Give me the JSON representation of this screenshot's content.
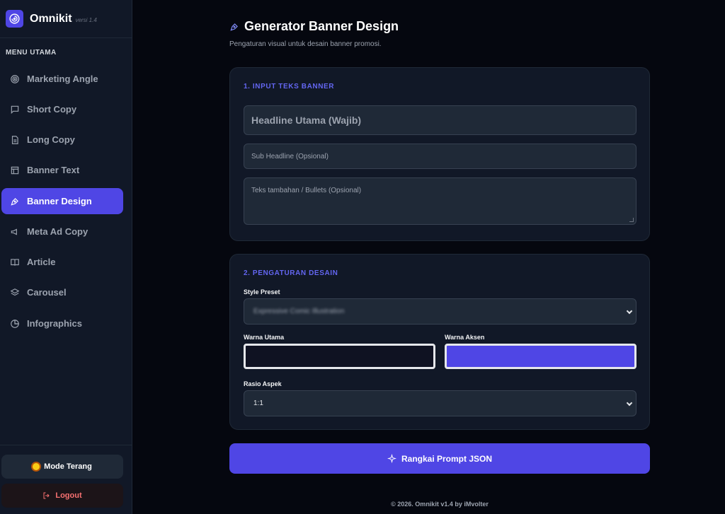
{
  "brand": {
    "name": "Omnikit",
    "version": "versi 1.4"
  },
  "sidebar": {
    "menu_title": "MENU UTAMA",
    "items": [
      {
        "label": "Marketing Angle",
        "icon": "target-icon"
      },
      {
        "label": "Short Copy",
        "icon": "message-square-icon"
      },
      {
        "label": "Long Copy",
        "icon": "file-text-icon"
      },
      {
        "label": "Banner Text",
        "icon": "layout-icon"
      },
      {
        "label": "Banner Design",
        "icon": "pen-tool-icon",
        "active": true
      },
      {
        "label": "Meta Ad Copy",
        "icon": "megaphone-icon"
      },
      {
        "label": "Article",
        "icon": "book-open-icon"
      },
      {
        "label": "Carousel",
        "icon": "layers-icon"
      },
      {
        "label": "Infographics",
        "icon": "pie-chart-icon"
      }
    ],
    "mode_label": "Mode Terang",
    "logout_label": "Logout"
  },
  "page": {
    "title": "Generator Banner Design",
    "subtitle": "Pengaturan visual untuk desain banner promosi."
  },
  "input_card": {
    "title": "1. INPUT TEKS BANNER",
    "headline_placeholder": "Headline Utama (Wajib)",
    "subheadline_placeholder": "Sub Headline (Opsional)",
    "extra_placeholder": "Teks tambahan / Bullets (Opsional)"
  },
  "design_card": {
    "title": "2. PENGATURAN DESAIN",
    "style_label": "Style Preset",
    "style_value": "Expressive Comic Illustration",
    "primary_label": "Warna Utama",
    "primary_color": "#0f1222",
    "accent_label": "Warna Aksen",
    "accent_color": "#4f46e5",
    "ratio_label": "Rasio Aspek",
    "ratio_value": "1:1"
  },
  "submit_label": "Rangkai Prompt JSON",
  "footer": "© 2026. Omnikit v1.4 by iMvolter"
}
